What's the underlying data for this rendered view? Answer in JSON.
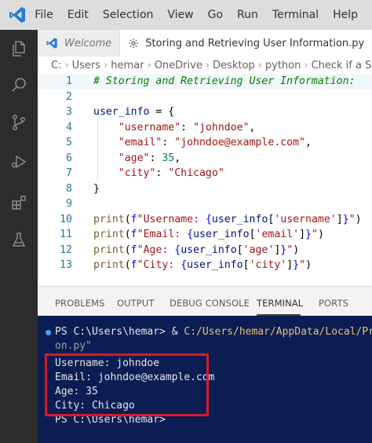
{
  "menu": [
    "File",
    "Edit",
    "Selection",
    "View",
    "Go",
    "Run",
    "Terminal",
    "Help"
  ],
  "tabs": [
    {
      "label": "Welcome"
    },
    {
      "label": "Storing and Retrieving User Information.py"
    }
  ],
  "breadcrumb": [
    "C:",
    "Users",
    "hemar",
    "OneDrive",
    "Desktop",
    "python",
    "Check if a Strin"
  ],
  "editor": {
    "line_numbers": [
      "1",
      "2",
      "3",
      "4",
      "5",
      "6",
      "7",
      "8",
      "9",
      "10",
      "11",
      "12",
      "13"
    ],
    "comment": "# Storing and Retrieving User Information:",
    "l3_var": "user_info",
    "l3_rest": " = {",
    "l4_key": "\"username\"",
    "l4_val": "\"johndoe\"",
    "l5_key": "\"email\"",
    "l5_val": "\"johndoe@example.com\"",
    "l6_key": "\"age\"",
    "l6_val": "35",
    "l7_key": "\"city\"",
    "l7_val": "\"Chicago\"",
    "l8": "}",
    "print_fn": "print",
    "l10_text": "Username: ",
    "l10_key": "'username'",
    "l11_text": "Email: ",
    "l11_key": "'email'",
    "l12_text": "Age: ",
    "l12_key": "'age'",
    "l13_text": "City: ",
    "l13_key": "'city'"
  },
  "panel": {
    "tabs": [
      "PROBLEMS",
      "OUTPUT",
      "DEBUG CONSOLE",
      "TERMINAL",
      "PORTS"
    ],
    "active_tab": "TERMINAL"
  },
  "terminal": {
    "prompt": "PS C:\\Users\\hemar> & ",
    "command_path": "C:/Users/hemar/AppData/Local/Progr",
    "command_cont": "on.py\"",
    "output": [
      "Username: johndoe",
      "Email: johndoe@example.com",
      "Age: 35",
      "City: Chicago"
    ],
    "prompt2": "PS C:\\Users\\hemar>"
  },
  "colors": {
    "accent": "#007acc",
    "terminal_bg": "#0b1d52",
    "highlight_box": "#d7192a"
  }
}
